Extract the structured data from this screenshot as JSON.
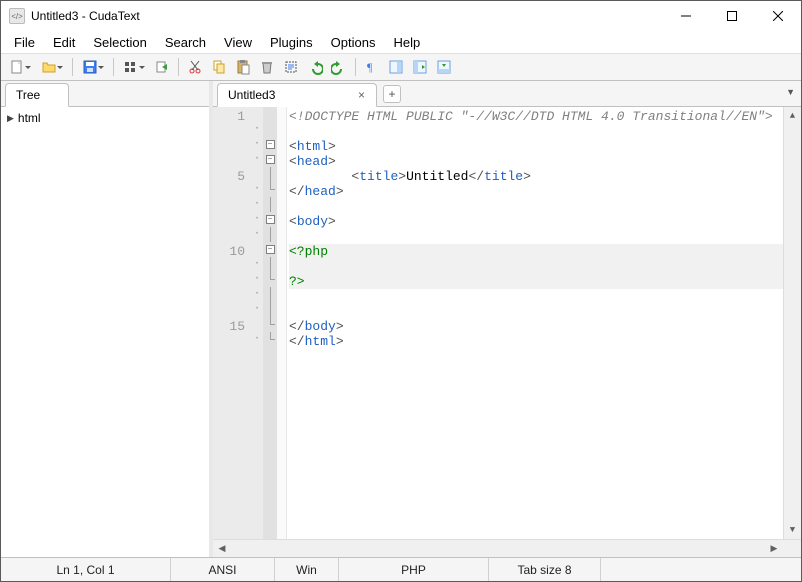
{
  "window": {
    "title": "Untitled3 - CudaText"
  },
  "menu": {
    "items": [
      "File",
      "Edit",
      "Selection",
      "Search",
      "View",
      "Plugins",
      "Options",
      "Help"
    ]
  },
  "toolbar": {
    "groups": [
      [
        "new-file",
        "open-file",
        "save-file",
        "system-menu",
        "goto"
      ],
      [
        "cut",
        "copy",
        "paste",
        "delete",
        "select-all",
        "undo",
        "redo"
      ],
      [
        "unprinted",
        "minimap",
        "side-panel",
        "bottom-panel"
      ]
    ]
  },
  "side_panel": {
    "tab_label": "Tree",
    "tree_root": "html"
  },
  "doc_tabs": {
    "active": "Untitled3"
  },
  "code_lines": [
    {
      "n": "1",
      "dot": "",
      "fold": "none",
      "type": "comment",
      "text": "<!DOCTYPE HTML PUBLIC \"-//W3C//DTD HTML 4.0 Transitional//EN\">"
    },
    {
      "n": "",
      "dot": "·",
      "fold": "none",
      "type": "blank",
      "text": ""
    },
    {
      "n": "",
      "dot": "·",
      "fold": "box-minus",
      "type": "tag",
      "open": "<",
      "name": "html",
      "close": ">"
    },
    {
      "n": "",
      "dot": "·",
      "fold": "box-minus",
      "type": "tag",
      "open": "<",
      "name": "head",
      "close": ">"
    },
    {
      "n": "5",
      "dot": "",
      "fold": "line",
      "type": "title",
      "indent": "        ",
      "open": "<",
      "name": "title",
      "close": ">",
      "text": "Untitled",
      "open2": "</",
      "name2": "title",
      "close2": ">"
    },
    {
      "n": "",
      "dot": "·",
      "fold": "end",
      "type": "tag",
      "open": "</",
      "name": "head",
      "close": ">"
    },
    {
      "n": "",
      "dot": "·",
      "fold": "line",
      "type": "blank",
      "text": ""
    },
    {
      "n": "",
      "dot": "·",
      "fold": "box-minus",
      "type": "tag",
      "open": "<",
      "name": "body",
      "close": ">"
    },
    {
      "n": "",
      "dot": "·",
      "fold": "line",
      "type": "blank",
      "text": ""
    },
    {
      "n": "10",
      "dot": "",
      "fold": "box-minus",
      "type": "php",
      "text": "<?php",
      "hl": true
    },
    {
      "n": "",
      "dot": "·",
      "fold": "line",
      "type": "blank",
      "text": "",
      "hl": true
    },
    {
      "n": "",
      "dot": "·",
      "fold": "end",
      "type": "php",
      "text": "?>",
      "hl": true
    },
    {
      "n": "",
      "dot": "·",
      "fold": "line",
      "type": "blank",
      "text": ""
    },
    {
      "n": "",
      "dot": "·",
      "fold": "line",
      "type": "blank",
      "text": ""
    },
    {
      "n": "15",
      "dot": "",
      "fold": "end",
      "type": "tag",
      "open": "</",
      "name": "body",
      "close": ">"
    },
    {
      "n": "",
      "dot": "·",
      "fold": "end",
      "type": "tag",
      "open": "</",
      "name": "html",
      "close": ">"
    }
  ],
  "status": {
    "pos": "Ln 1, Col 1",
    "enc": "ANSI",
    "eol": "Win",
    "lexer": "PHP",
    "tab": "Tab size 8",
    "msg": ""
  },
  "colors": {
    "accent": "#2060c0",
    "php": "#008000",
    "comment": "#808080"
  }
}
